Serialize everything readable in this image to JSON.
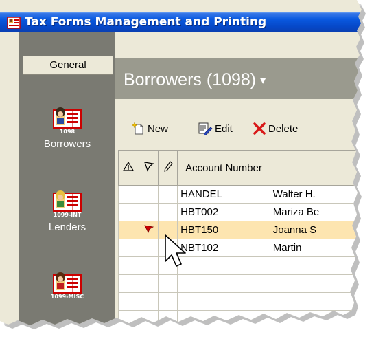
{
  "window": {
    "title": "Tax Forms Management and Printing"
  },
  "sidebar": {
    "general_label": "General",
    "items": [
      {
        "code": "1098",
        "label": "Borrowers",
        "icon": "form-1098-icon"
      },
      {
        "code": "1099-INT",
        "label": "Lenders",
        "icon": "form-1099-int-icon"
      },
      {
        "code": "1099-MISC",
        "label": "",
        "icon": "form-1099-misc-icon"
      }
    ]
  },
  "header": {
    "title": "Borrowers (1098)",
    "caret": "▾"
  },
  "toolbar": {
    "new_label": "New",
    "edit_label": "Edit",
    "delete_label": "Delete"
  },
  "grid": {
    "columns": [
      {
        "label": "",
        "icon": "warning-icon"
      },
      {
        "label": "",
        "icon": "flag-icon"
      },
      {
        "label": "",
        "icon": "pencil-icon"
      },
      {
        "label": "Account Number"
      },
      {
        "label": ""
      }
    ],
    "rows": [
      {
        "account": "HANDEL",
        "name": "Walter H.",
        "flag": false,
        "selected": false
      },
      {
        "account": "HBT002",
        "name": "Mariza Be",
        "flag": false,
        "selected": false
      },
      {
        "account": "HBT150",
        "name": "Joanna S",
        "flag": true,
        "selected": true
      },
      {
        "account": "NBT102",
        "name": "Martin",
        "flag": false,
        "selected": false
      },
      {
        "account": "",
        "name": "",
        "flag": false,
        "selected": false
      },
      {
        "account": "",
        "name": "",
        "flag": false,
        "selected": false
      },
      {
        "account": "",
        "name": "",
        "flag": false,
        "selected": false
      },
      {
        "account": "",
        "name": "",
        "flag": false,
        "selected": false
      }
    ]
  },
  "colors": {
    "titlebar": "#0a5ae0",
    "sidebar": "#7b7b73",
    "header_band": "#9a9a8e",
    "selected_row": "#fde5b0",
    "flag": "#cc0000"
  }
}
